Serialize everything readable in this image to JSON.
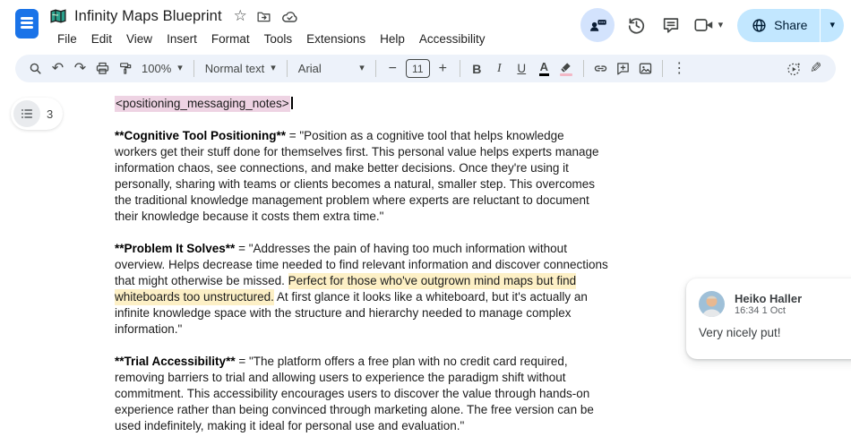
{
  "header": {
    "title": "Infinity Maps Blueprint",
    "menus": [
      "File",
      "Edit",
      "View",
      "Insert",
      "Format",
      "Tools",
      "Extensions",
      "Help",
      "Accessibility"
    ],
    "share_label": "Share"
  },
  "toolbar": {
    "zoom": "100%",
    "paragraph_style": "Normal text",
    "font": "Arial",
    "font_size": "11"
  },
  "outline": {
    "count": "3"
  },
  "icons": {
    "star": "☆",
    "undo": "↶",
    "redo": "↷",
    "more_vertical": "⋮",
    "pencil": "✎",
    "caret_down": "▾",
    "minus": "−",
    "plus": "+",
    "bold": "B",
    "italic": "I",
    "underline": "U",
    "text_color": "A"
  },
  "document": {
    "tag_line": "<positioning_messaging_notes>",
    "paragraphs": [
      {
        "segments": [
          {
            "text": "**Cognitive Tool Positioning**"
          },
          {
            "text": " = \"Position as a cognitive tool that helps knowledge workers get their stuff done for themselves first. This personal value helps experts manage information chaos, see connections, and make better decisions. Once they're using it personally, sharing with teams or clients becomes a natural, smaller step. This overcomes the traditional knowledge management problem where experts are reluctant to document their knowledge because it costs them extra time.\""
          }
        ]
      },
      {
        "segments": [
          {
            "text": "**Problem It Solves**"
          },
          {
            "text": " = \"Addresses the pain of having too much information without overview. Helps decrease time needed to find relevant information and discover connections that might otherwise be missed. "
          },
          {
            "text": "Perfect for those who've outgrown mind maps but find whiteboards too unstructured."
          },
          {
            "text": " At first glance it looks like a whiteboard, but it's actually an infinite knowledge space with the structure and hierarchy needed to manage complex information.\""
          }
        ]
      },
      {
        "segments": [
          {
            "text": "**Trial Accessibility**"
          },
          {
            "text": " = \"The platform offers a free plan with no credit card required, removing barriers to trial and allowing users to experience the paradigm shift without commitment. This accessibility encourages users to discover the value through hands-on experience rather than being convinced through marketing alone. The free version can be used indefinitely, making it ideal for personal use and evaluation.\""
          }
        ]
      }
    ]
  },
  "comment": {
    "author": "Heiko Haller",
    "time": "16:34 1 Oct",
    "text": "Very nicely put!"
  },
  "colors": {
    "share_accent": "#c2e7ff",
    "toolbar_bg": "#edf2fa",
    "pink_highlight": "#eed3e3",
    "yellow_highlight": "#fdf0c6",
    "presence_bg": "#d3e3fd",
    "icon_gray": "#444746"
  }
}
